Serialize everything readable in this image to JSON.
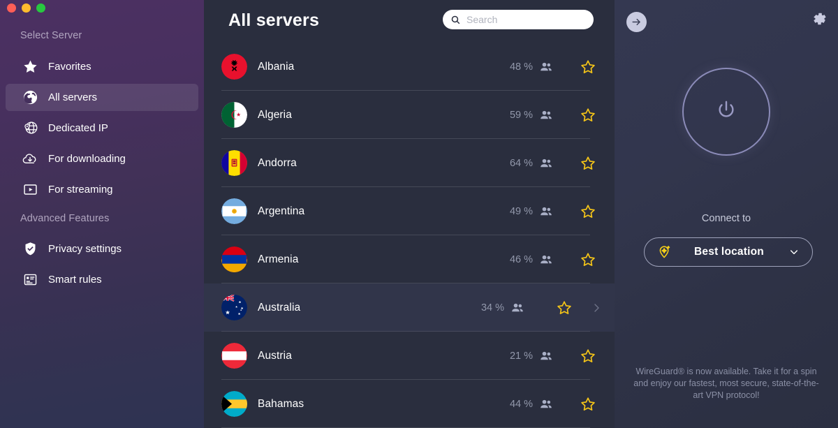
{
  "window": {
    "traffic_lights": [
      {
        "name": "close",
        "color": "#ff5f57"
      },
      {
        "name": "minimize",
        "color": "#febc2e"
      },
      {
        "name": "maximize",
        "color": "#28c840"
      }
    ]
  },
  "sidebar": {
    "section_title": "Select Server",
    "advanced_title": "Advanced Features",
    "items": [
      {
        "label": "Favorites",
        "icon": "star-icon",
        "active": false
      },
      {
        "label": "All servers",
        "icon": "globe-icon",
        "active": true
      },
      {
        "label": "Dedicated IP",
        "icon": "globe-pin-icon",
        "active": false
      },
      {
        "label": "For downloading",
        "icon": "cloud-download-icon",
        "active": false
      },
      {
        "label": "For streaming",
        "icon": "play-screen-icon",
        "active": false
      }
    ],
    "advanced_items": [
      {
        "label": "Privacy settings",
        "icon": "shield-check-icon",
        "active": false
      },
      {
        "label": "Smart rules",
        "icon": "rules-list-icon",
        "active": false
      }
    ]
  },
  "list": {
    "title": "All servers",
    "search": {
      "placeholder": "Search",
      "value": "",
      "icon": "search-icon"
    },
    "columns": [
      "country",
      "load",
      "favorite"
    ],
    "servers": [
      {
        "country": "Albania",
        "load": "48 %",
        "flag": "albania-flag",
        "favorite": false,
        "hovered": false
      },
      {
        "country": "Algeria",
        "load": "59 %",
        "flag": "algeria-flag",
        "favorite": false,
        "hovered": false
      },
      {
        "country": "Andorra",
        "load": "64 %",
        "flag": "andorra-flag",
        "favorite": false,
        "hovered": false
      },
      {
        "country": "Argentina",
        "load": "49 %",
        "flag": "argentina-flag",
        "favorite": false,
        "hovered": false
      },
      {
        "country": "Armenia",
        "load": "46 %",
        "flag": "armenia-flag",
        "favorite": false,
        "hovered": false
      },
      {
        "country": "Australia",
        "load": "34 %",
        "flag": "australia-flag",
        "favorite": false,
        "hovered": true
      },
      {
        "country": "Austria",
        "load": "21 %",
        "flag": "austria-flag",
        "favorite": false,
        "hovered": false
      },
      {
        "country": "Bahamas",
        "load": "44 %",
        "flag": "bahamas-flag",
        "favorite": false,
        "hovered": false
      }
    ]
  },
  "right_panel": {
    "back_icon": "arrow-right-circle-icon",
    "settings_icon": "gear-icon",
    "power_icon": "power-icon",
    "connect_label": "Connect to",
    "location_button": {
      "label": "Best location",
      "icon": "location-pin-sparkle-icon",
      "chevron": "chevron-down-icon"
    },
    "promo_text": "WireGuard® is now available. Take it for a spin and enjoy our fastest, most secure, state-of-the-art VPN protocol!"
  },
  "colors": {
    "sidebar_top": "#4c3062",
    "sidebar_bottom": "#2e3352",
    "list_bg": "#2a2e3e",
    "panel_bg": "#343851",
    "star_yellow": "#f5c518",
    "accent_ring": "#8b8bb8",
    "load_text": "#9298ab"
  }
}
